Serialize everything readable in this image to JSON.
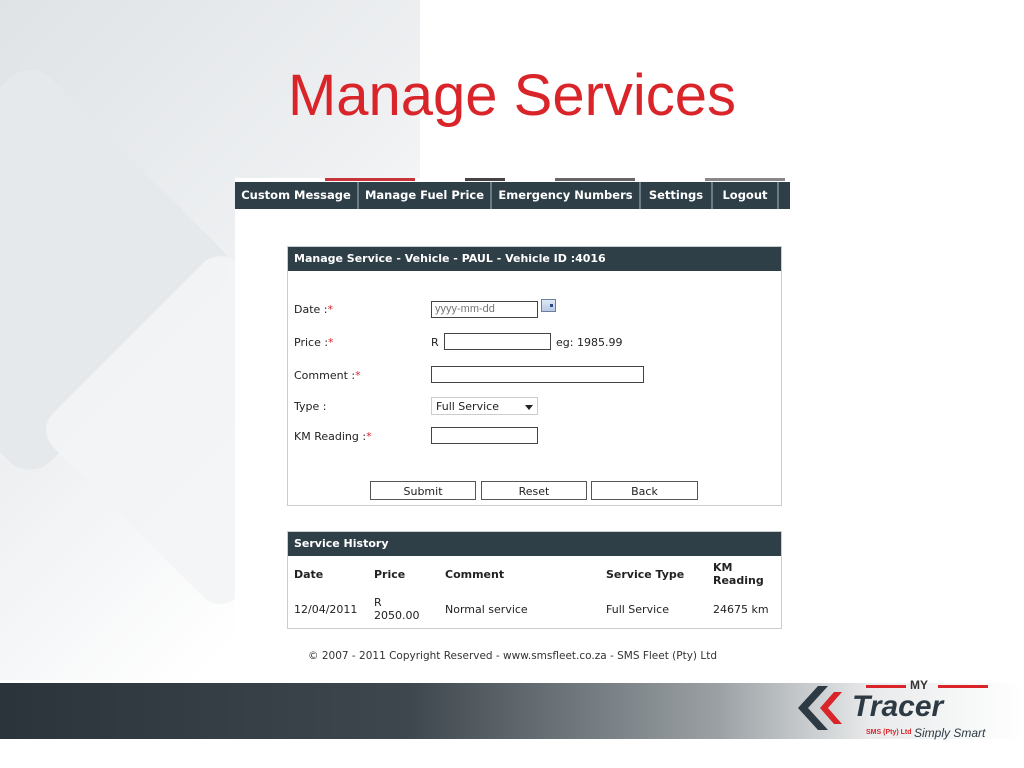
{
  "slide": {
    "title": "Manage Services"
  },
  "nav": {
    "items": [
      "Custom Message",
      "Manage Fuel Price",
      "Emergency Numbers",
      "Settings",
      "Logout"
    ]
  },
  "form": {
    "header": "Manage Service - Vehicle - PAUL - Vehicle ID :4016",
    "date_label": "Date :",
    "date_placeholder": "yyyy-mm-dd",
    "price_label": "Price :",
    "price_prefix": "R",
    "price_value": "",
    "price_example": "eg: 1985.99",
    "comment_label": "Comment :",
    "comment_value": "",
    "type_label": "Type :",
    "type_selected": "Full Service",
    "km_label": "KM Reading :",
    "km_value": "",
    "required_mark": "*",
    "submit_label": "Submit",
    "reset_label": "Reset",
    "back_label": "Back"
  },
  "history": {
    "header": "Service History",
    "columns": [
      "Date",
      "Price",
      "Comment",
      "Service Type",
      "KM Reading"
    ],
    "rows": [
      {
        "date": "12/04/2011",
        "price": "R 2050.00",
        "comment": "Normal service",
        "type": "Full Service",
        "km": "24675 km"
      }
    ]
  },
  "footer": {
    "text": "© 2007 - 2011 Copyright Reserved - www.smsfleet.co.za - SMS Fleet (Pty) Ltd"
  },
  "logo": {
    "my": "MY",
    "word": "Tracer",
    "sms": "SMS (Pty) Ltd",
    "tagline": "Simply Smart"
  },
  "colors": {
    "accent": "#d9252a",
    "header_bg": "#2f3f47"
  }
}
